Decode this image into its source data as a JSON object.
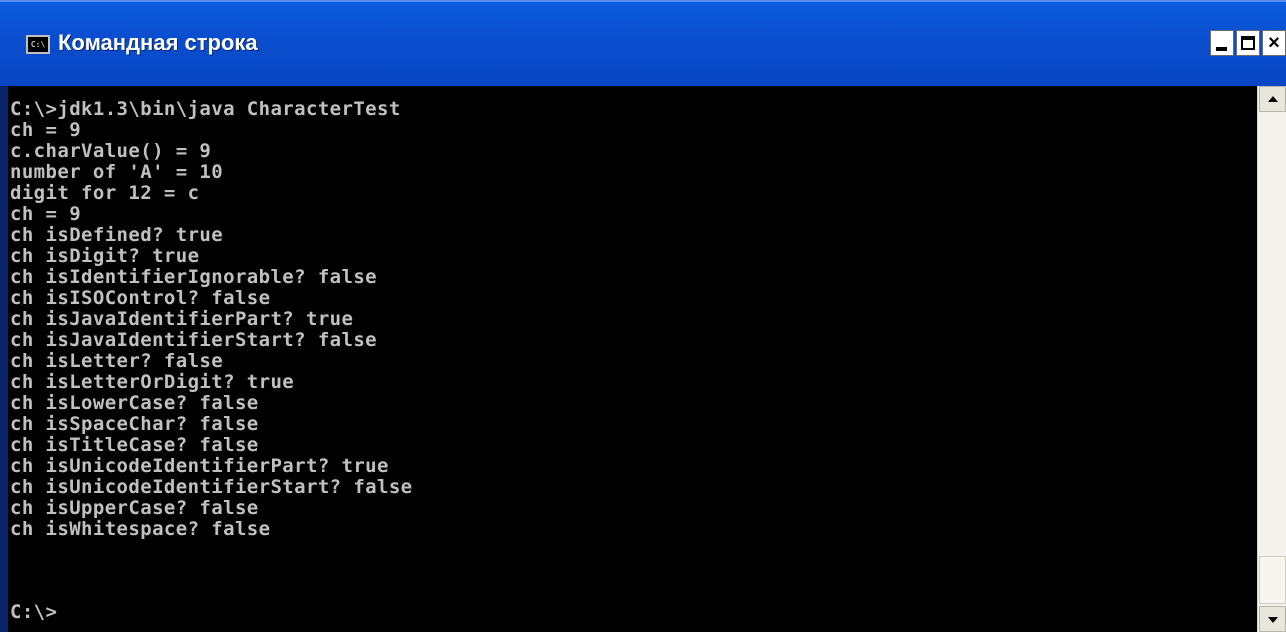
{
  "window": {
    "title": "Командная строка",
    "icon": "cmd-icon",
    "icon_text": "C:\\",
    "controls": {
      "minimize": "minimize-icon",
      "maximize": "maximize-icon",
      "close_label": "×"
    }
  },
  "console": {
    "lines": [
      "C:\\>jdk1.3\\bin\\java CharacterTest",
      "ch = 9",
      "c.charValue() = 9",
      "number of 'A' = 10",
      "digit for 12 = c",
      "ch = 9",
      "ch isDefined? true",
      "ch isDigit? true",
      "ch isIdentifierIgnorable? false",
      "ch isISOControl? false",
      "ch isJavaIdentifierPart? true",
      "ch isJavaIdentifierStart? false",
      "ch isLetter? false",
      "ch isLetterOrDigit? true",
      "ch isLowerCase? false",
      "ch isSpaceChar? false",
      "ch isTitleCase? false",
      "ch isUnicodeIdentifierPart? true",
      "ch isUnicodeIdentifierStart? false",
      "ch isUpperCase? false",
      "ch isWhitespace? false",
      "",
      "C:\\>"
    ],
    "text_color": "#c0c0c0",
    "background_color": "#000000"
  },
  "scrollbar": {
    "up_icon": "scroll-up-arrow-icon",
    "down_icon": "scroll-down-arrow-icon"
  }
}
